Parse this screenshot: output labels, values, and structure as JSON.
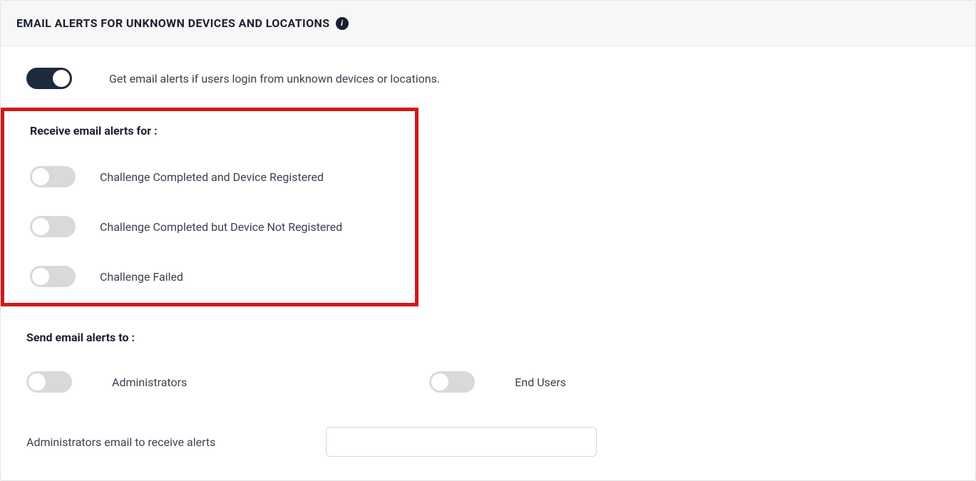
{
  "header": {
    "title": "EMAIL ALERTS FOR UNKNOWN DEVICES AND LOCATIONS",
    "info_glyph": "i"
  },
  "main_toggle": {
    "on": true,
    "description": "Get email alerts if users login from unknown devices or locations."
  },
  "receive_alerts": {
    "label": "Receive email alerts for :",
    "options": [
      {
        "label": "Challenge Completed and Device Registered",
        "on": false
      },
      {
        "label": "Challenge Completed but Device Not Registered",
        "on": false
      },
      {
        "label": "Challenge Failed",
        "on": false
      }
    ]
  },
  "send_alerts": {
    "label": "Send email alerts to :",
    "recipients": [
      {
        "label": "Administrators",
        "on": false
      },
      {
        "label": "End Users",
        "on": false
      }
    ]
  },
  "admin_email": {
    "label": "Administrators email to receive alerts",
    "value": ""
  }
}
